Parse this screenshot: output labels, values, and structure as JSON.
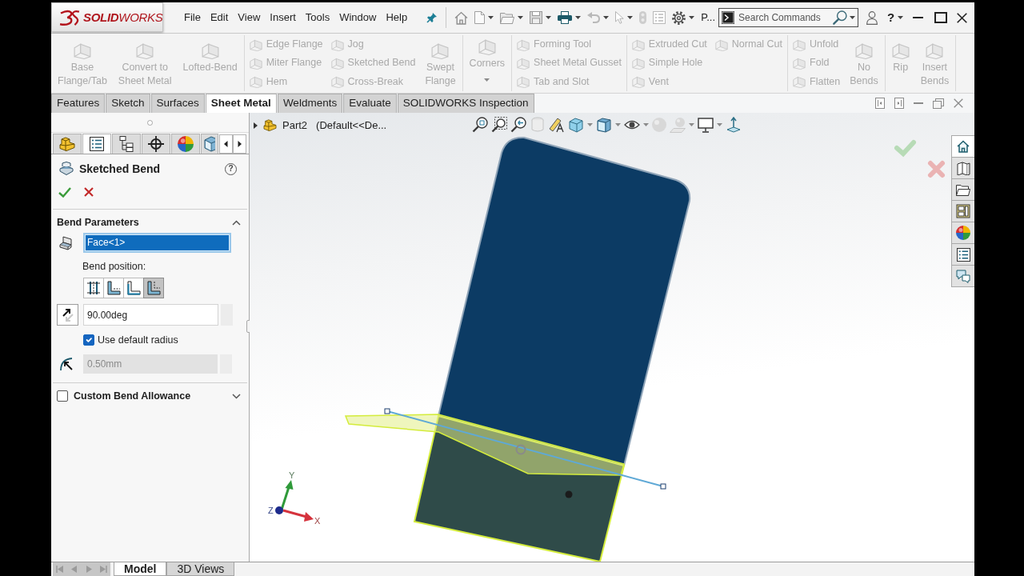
{
  "app": {
    "logo": "**SOLID**WORKS"
  },
  "menu": [
    "File",
    "Edit",
    "View",
    "Insert",
    "Tools",
    "Window",
    "Help"
  ],
  "quick_access": {
    "overflow": "P..."
  },
  "search": {
    "placeholder": "Search Commands"
  },
  "window_controls": {
    "help": "?"
  },
  "ribbon": {
    "groups": [
      {
        "columns": [
          {
            "kind": "large",
            "items": [
              {
                "label": "Base\nFlange/Tab",
                "disabled": true
              }
            ]
          },
          {
            "kind": "large",
            "items": [
              {
                "label": "Convert to\nSheet Metal",
                "disabled": true
              }
            ]
          },
          {
            "kind": "large",
            "items": [
              {
                "label": "Lofted-Bend",
                "disabled": true
              }
            ]
          }
        ]
      },
      {
        "columns": [
          {
            "kind": "stack",
            "items": [
              {
                "label": "Edge Flange",
                "disabled": true
              },
              {
                "label": "Miter Flange",
                "disabled": true
              },
              {
                "label": "Hem",
                "disabled": true
              }
            ]
          },
          {
            "kind": "stack",
            "items": [
              {
                "label": "Jog",
                "disabled": true
              },
              {
                "label": "Sketched Bend",
                "disabled": true
              },
              {
                "label": "Cross-Break",
                "disabled": true
              }
            ]
          },
          {
            "kind": "large",
            "items": [
              {
                "label": "Swept\nFlange",
                "disabled": true
              }
            ]
          }
        ]
      },
      {
        "columns": [
          {
            "kind": "large",
            "items": [
              {
                "label": "Corners",
                "disabled": true,
                "dropdown": true
              }
            ]
          }
        ]
      },
      {
        "columns": [
          {
            "kind": "stack",
            "items": [
              {
                "label": "Forming Tool",
                "disabled": true
              },
              {
                "label": "Sheet Metal Gusset",
                "disabled": true
              },
              {
                "label": "Tab and Slot",
                "disabled": true
              }
            ]
          }
        ]
      },
      {
        "columns": [
          {
            "kind": "stack",
            "items": [
              {
                "label": "Extruded Cut",
                "disabled": true
              },
              {
                "label": "Simple Hole",
                "disabled": true
              },
              {
                "label": "Vent",
                "disabled": true
              }
            ]
          },
          {
            "kind": "stack",
            "items": [
              {
                "label": "Normal Cut",
                "disabled": true
              }
            ]
          }
        ]
      },
      {
        "columns": [
          {
            "kind": "stack",
            "items": [
              {
                "label": "Unfold",
                "disabled": true
              },
              {
                "label": "Fold",
                "disabled": true
              },
              {
                "label": "Flatten",
                "disabled": true
              }
            ]
          },
          {
            "kind": "large",
            "items": [
              {
                "label": "No\nBends",
                "disabled": true
              }
            ]
          }
        ]
      },
      {
        "columns": [
          {
            "kind": "large",
            "items": [
              {
                "label": "Rip",
                "disabled": true
              }
            ]
          },
          {
            "kind": "large",
            "items": [
              {
                "label": "Insert\nBends",
                "disabled": true
              }
            ]
          }
        ]
      }
    ]
  },
  "command_tabs": [
    {
      "label": "Features",
      "selected": false
    },
    {
      "label": "Sketch",
      "selected": false
    },
    {
      "label": "Surfaces",
      "selected": false
    },
    {
      "label": "Sheet Metal",
      "selected": true
    },
    {
      "label": "Weldments",
      "selected": false
    },
    {
      "label": "Evaluate",
      "selected": false
    },
    {
      "label": "SOLIDWORKS Inspection",
      "selected": false
    }
  ],
  "property_manager": {
    "tabs": [
      {
        "selected": false
      },
      {
        "selected": true
      },
      {
        "selected": false
      },
      {
        "selected": false
      },
      {
        "selected": false
      },
      {
        "selected": false
      }
    ],
    "title": "Sketched Bend",
    "help": "?",
    "sections": [
      {
        "kind": "bend_parameters",
        "title": "Bend Parameters",
        "expanded": true,
        "face_field": {
          "value": "Face<1>",
          "active": true
        },
        "bend_position": {
          "label": "Bend position:",
          "options": [
            {
              "selected": false
            },
            {
              "selected": false
            },
            {
              "selected": false
            },
            {
              "selected": true
            }
          ]
        },
        "angle": {
          "value": "90.00deg"
        },
        "default_radius": {
          "label": "Use default radius",
          "checked": true
        },
        "radius": {
          "value": "0.50mm",
          "disabled": true
        }
      },
      {
        "kind": "custom_allowance",
        "title": "Custom Bend Allowance",
        "checked": false,
        "expanded": false
      }
    ]
  },
  "viewport": {
    "tree": {
      "expanded": false,
      "name": "Part2",
      "configuration": "(Default<<De..."
    },
    "triad": {
      "x": "X",
      "y": "Y",
      "z": "Z"
    }
  },
  "task_pane": {
    "tabs": [
      {
        "selected": true
      },
      {
        "selected": false
      },
      {
        "selected": false
      },
      {
        "selected": false
      },
      {
        "selected": false
      },
      {
        "selected": false
      },
      {
        "selected": false
      }
    ]
  },
  "bottom_tabs": [
    {
      "label": "Model",
      "selected": true
    },
    {
      "label": "3D Views",
      "selected": false
    }
  ]
}
